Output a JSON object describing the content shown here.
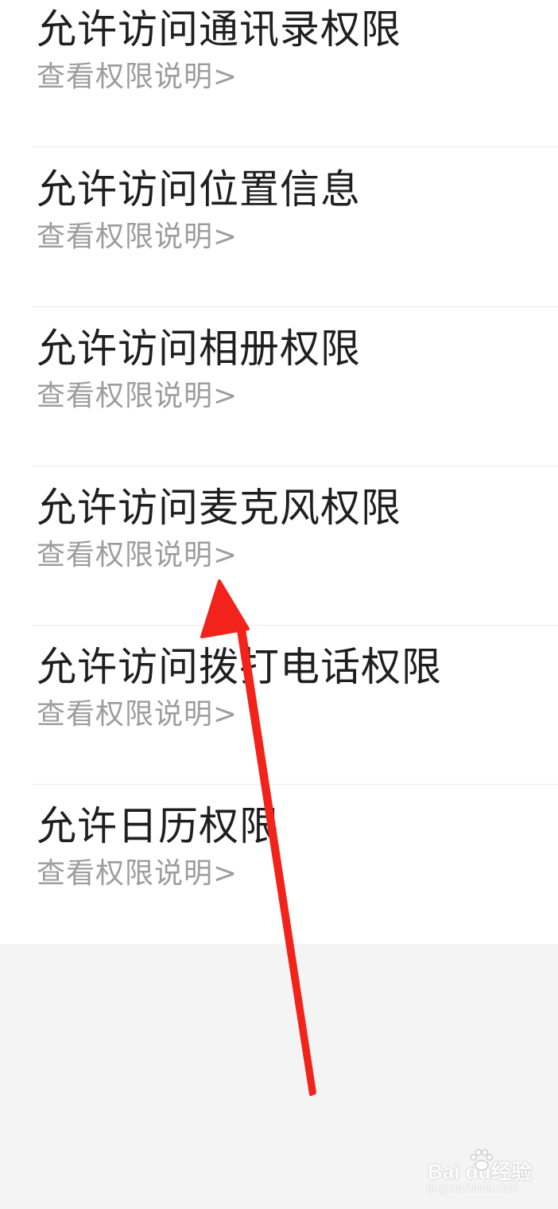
{
  "permissions": [
    {
      "title": "允许访问通讯录权限",
      "link": "查看权限说明>"
    },
    {
      "title": "允许访问位置信息",
      "link": "查看权限说明>"
    },
    {
      "title": "允许访问相册权限",
      "link": "查看权限说明>"
    },
    {
      "title": "允许访问麦克风权限",
      "link": "查看权限说明>"
    },
    {
      "title": "允许访问拨打电话权限",
      "link": "查看权限说明>"
    },
    {
      "title": "允许日历权限",
      "link": "查看权限说明>"
    }
  ],
  "colors": {
    "title_text": "#1f1f1f",
    "link_text": "#9d9d9d",
    "list_background": "#ffffff",
    "page_background": "#f4f4f4",
    "annotation_arrow": "#f2231a"
  },
  "annotation": {
    "icon": "red-arrow-icon",
    "target": "查看权限说明>"
  },
  "watermark": {
    "brand": "Bai du经验",
    "url": "jingyan.baidu.com"
  }
}
